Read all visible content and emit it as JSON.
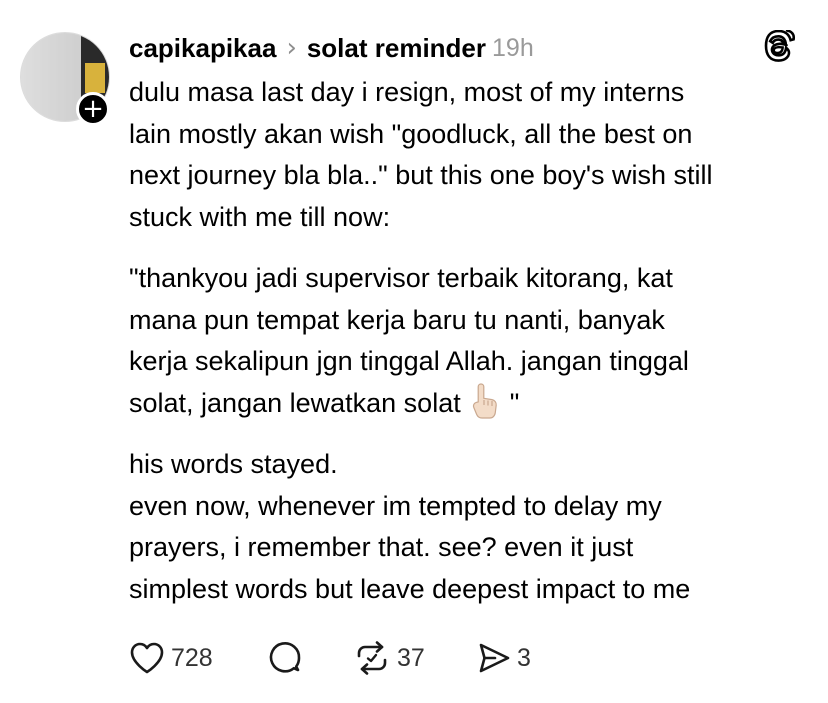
{
  "post": {
    "username": "capikapikaa",
    "separator": "›",
    "topic": "solat reminder",
    "timestamp": "19h",
    "follow_icon": "plus-icon",
    "app_icon": "threads-logo-icon",
    "body": [
      [
        "dulu masa last day i resign, most of my interns",
        "lain mostly akan wish \"goodluck, all the best on",
        "next journey bla bla..\" but this one boy's wish still",
        "stuck with me till now:"
      ],
      [
        "\"thankyou jadi supervisor terbaik kitorang, kat",
        "mana pun tempat kerja baru tu nanti, banyak",
        "kerja sekalipun jgn tinggal Allah. jangan tinggal",
        "solat, jangan lewatkan solat"
      ],
      [
        "his words stayed."
      ],
      [
        "even now, whenever im tempted to delay my",
        "prayers, i remember that. see? even it just",
        "simplest words but leave deepest impact to me"
      ]
    ],
    "quote_tail": "\"",
    "emoji_name": "index-pointing-up-emoji"
  },
  "actions": {
    "likes": "728",
    "comments": "",
    "reposts": "37",
    "shares": "3"
  },
  "colors": {
    "text": "#000000",
    "secondary": "#9a9a9a",
    "badge": "#000000"
  }
}
